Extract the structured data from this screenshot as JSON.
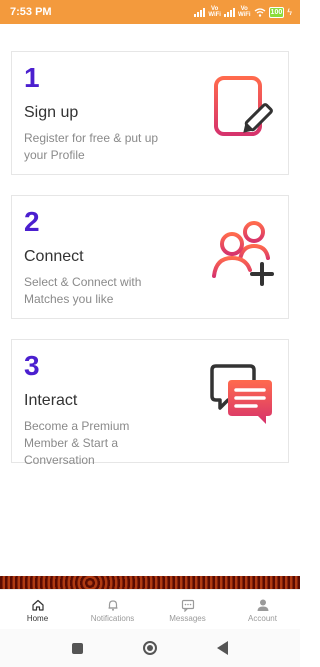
{
  "status": {
    "time": "7:53 PM",
    "battery": "100",
    "vowifi_top": "Vo",
    "vowifi_bottom": "WiFi"
  },
  "steps": [
    {
      "number": "1",
      "title": "Sign up",
      "description": "Register for free & put up your Profile",
      "icon": "signup-form-icon"
    },
    {
      "number": "2",
      "title": "Connect",
      "description": "Select & Connect with Matches you like",
      "icon": "add-users-icon"
    },
    {
      "number": "3",
      "title": "Interact",
      "description": "Become a Premium Member & Start a Conversation",
      "icon": "chat-bubbles-icon"
    }
  ],
  "bottom_nav": [
    {
      "label": "Home",
      "icon": "home-icon",
      "active": true
    },
    {
      "label": "Notifications",
      "icon": "bell-icon",
      "active": false
    },
    {
      "label": "Messages",
      "icon": "message-icon",
      "active": false
    },
    {
      "label": "Account",
      "icon": "user-icon",
      "active": false
    }
  ],
  "colors": {
    "status_bar": "#f39a3d",
    "accent_number": "#4b1fcf",
    "icon_gradient_start": "#ff6a4d",
    "icon_gradient_end": "#d6336c"
  }
}
